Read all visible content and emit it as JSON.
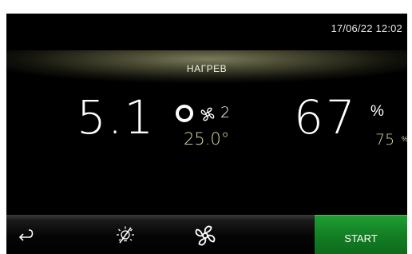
{
  "header": {
    "datetime": "17/06/22 12:02"
  },
  "mode": {
    "label": "НАГРЕВ"
  },
  "temperature": {
    "current": "5.1",
    "setpoint": "25.0°",
    "fan_speed": "2"
  },
  "humidity": {
    "current": "67",
    "unit": "%",
    "setpoint": "75",
    "setpoint_unit": "%"
  },
  "toolbar": {
    "back_icon": "return-arrow-icon",
    "light_icon": "light-off-icon",
    "fan_icon": "fan-icon",
    "start_label": "START"
  },
  "colors": {
    "background": "#000000",
    "setpoint_text": "#d8dca0",
    "start_green": "#138024",
    "mode_band": "#7a7a5c"
  }
}
